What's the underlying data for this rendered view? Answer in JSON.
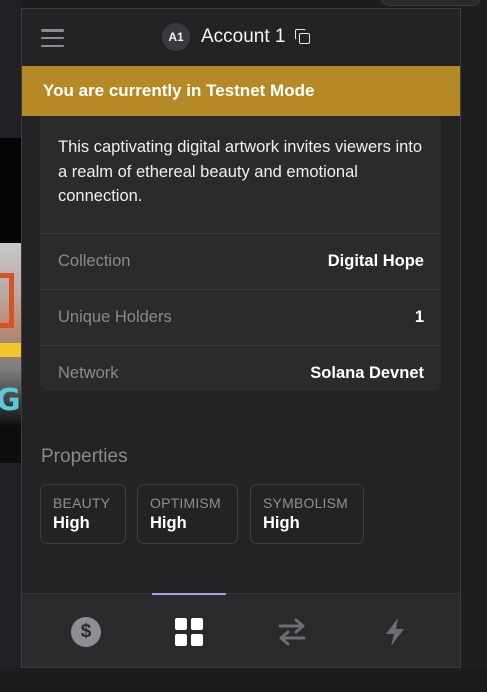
{
  "header": {
    "avatar_initials": "A1",
    "account_name": "Account 1"
  },
  "banner": {
    "text": "You are currently in Testnet Mode",
    "color": "#b58a26"
  },
  "details": {
    "description": "This captivating digital artwork invites viewers into a realm of ethereal beauty and emotional connection.",
    "rows": [
      {
        "label": "Collection",
        "value": "Digital Hope"
      },
      {
        "label": "Unique Holders",
        "value": "1"
      },
      {
        "label": "Network",
        "value": "Solana Devnet"
      }
    ]
  },
  "properties": {
    "title": "Properties",
    "items": [
      {
        "key": "BEAUTY",
        "value": "High"
      },
      {
        "key": "OPTIMISM",
        "value": "High"
      },
      {
        "key": "SYMBOLISM",
        "value": "High"
      }
    ]
  },
  "tabbar": {
    "tabs": [
      {
        "icon": "dollar-icon",
        "active": false
      },
      {
        "icon": "grid-icon",
        "active": true
      },
      {
        "icon": "swap-icon",
        "active": false
      },
      {
        "icon": "lightning-icon",
        "active": false
      }
    ],
    "active_color": "#a99cf2"
  }
}
